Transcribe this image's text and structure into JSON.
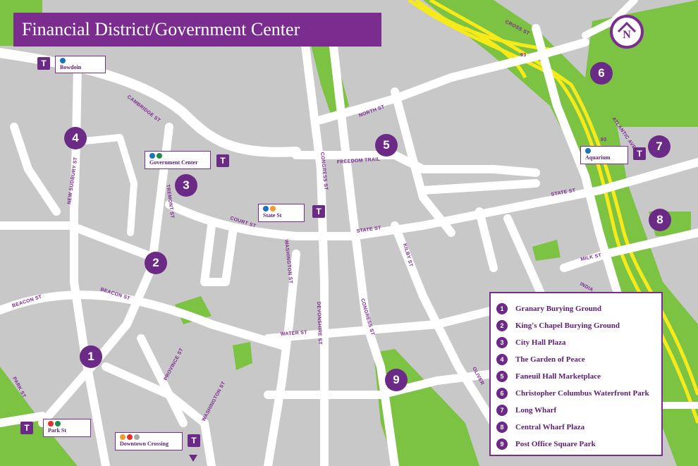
{
  "title": "Financial District/Government Center",
  "compass": {
    "letter": "N"
  },
  "streets": {
    "cambridge": "CAMBRIDGE ST",
    "new_sudbury": "NEW SUDBURY ST",
    "tremont": "TREMONT ST",
    "court": "COURT ST",
    "state_st_1": "STATE ST",
    "state_st_2": "STATE ST",
    "beacon_1": "BEACON ST",
    "beacon_2": "BEACON ST",
    "province": "PROVINCE ST",
    "washington_1": "WASHINGTON ST",
    "washington_2": "WASHINGTON ST",
    "park": "PARK ST",
    "congress_1": "CONGRESS ST",
    "congress_2": "CONGRESS ST",
    "devonshire": "DEVONSHIRE ST",
    "water": "WATER ST",
    "kilby": "KILBY ST",
    "north": "NORTH ST",
    "freedom_trail": "FREEDOM TRAIL",
    "cross": "CROSS ST",
    "atlantic": "ATLANTIC AVE",
    "milk": "MILK ST",
    "oliver": "OLIVER",
    "india": "INDIA",
    "i93_1": "93",
    "i93_2": "93"
  },
  "markers": [
    "1",
    "2",
    "3",
    "4",
    "5",
    "6",
    "7",
    "8",
    "9"
  ],
  "stations": {
    "bowdoin": {
      "t": "T",
      "name": "Bowdoin"
    },
    "government_center": {
      "t": "T",
      "name": "Government Center"
    },
    "state_st": {
      "t": "T",
      "name": "State St"
    },
    "aquarium": {
      "t": "T",
      "name": "Aquarium"
    },
    "park_st": {
      "t": "T",
      "name": "Park St"
    },
    "downtown_crossing": {
      "t": "T",
      "name": "Downtown Crossing"
    }
  },
  "legend": [
    {
      "num": "1",
      "label": "Granary Burying Ground"
    },
    {
      "num": "2",
      "label": "King's Chapel Burying Ground"
    },
    {
      "num": "3",
      "label": "City Hall Plaza"
    },
    {
      "num": "4",
      "label": "The Garden of Peace"
    },
    {
      "num": "5",
      "label": "Faneuil Hall Marketplace"
    },
    {
      "num": "6",
      "label": "Christopher Columbus Waterfront Park"
    },
    {
      "num": "7",
      "label": "Long Wharf"
    },
    {
      "num": "8",
      "label": "Central Wharf Plaza"
    },
    {
      "num": "9",
      "label": "Post Office Square Park"
    }
  ],
  "colors": {
    "brand_purple": "#7a2d8f",
    "park_green": "#7cc243",
    "highway_yellow": "#f7ea1b",
    "street_white": "#ffffff",
    "background_gray": "#c8c8c8",
    "line_blue": "#1d72b8",
    "line_green": "#1f8d4b",
    "line_orange": "#f29a2e",
    "line_red": "#e0302b",
    "line_silver": "#a9a9a9"
  }
}
